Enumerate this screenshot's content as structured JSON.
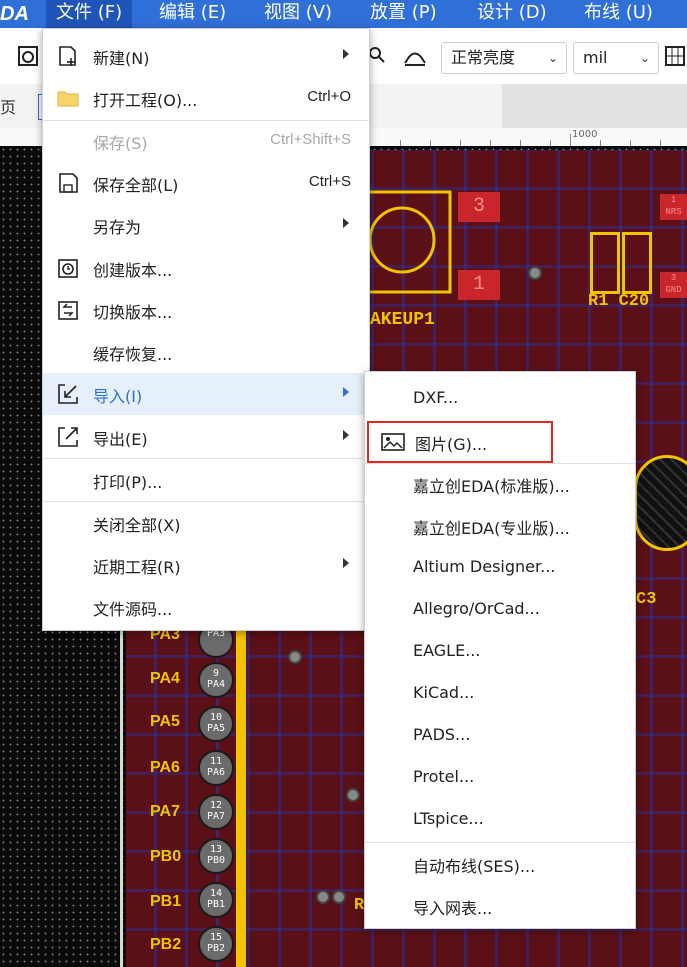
{
  "menubar": {
    "logo": "DA",
    "items": [
      {
        "label": "文件 (F)"
      },
      {
        "label": "编辑 (E)"
      },
      {
        "label": "视图 (V)"
      },
      {
        "label": "放置 (P)"
      },
      {
        "label": "设计 (D)"
      },
      {
        "label": "布线 (U)"
      }
    ]
  },
  "toolbar": {
    "brightness_select": "正常亮度",
    "unit_select": "mil"
  },
  "tabbar": {
    "left_fragment": "页"
  },
  "ruler": {
    "label": "1000"
  },
  "file_menu": {
    "items": [
      {
        "label": "新建(N)",
        "shortcut": "",
        "icon": "new-file-icon"
      },
      {
        "label": "打开工程(O)...",
        "shortcut": "Ctrl+O",
        "icon": "folder-icon"
      },
      {
        "label": "保存(S)",
        "shortcut": "Ctrl+Shift+S"
      },
      {
        "label": "保存全部(L)",
        "shortcut": "Ctrl+S",
        "icon": "save-icon"
      },
      {
        "label": "另存为",
        "shortcut": ""
      },
      {
        "label": "创建版本...",
        "shortcut": "",
        "icon": "create-version-icon"
      },
      {
        "label": "切换版本...",
        "shortcut": "",
        "icon": "switch-version-icon"
      },
      {
        "label": "缓存恢复...",
        "shortcut": ""
      },
      {
        "label": "导入(I)",
        "shortcut": "",
        "icon": "import-icon"
      },
      {
        "label": "导出(E)",
        "shortcut": "",
        "icon": "export-icon"
      },
      {
        "label": "打印(P)...",
        "shortcut": ""
      },
      {
        "label": "关闭全部(X)",
        "shortcut": ""
      },
      {
        "label": "近期工程(R)",
        "shortcut": ""
      },
      {
        "label": "文件源码...",
        "shortcut": ""
      }
    ]
  },
  "import_submenu": {
    "items": [
      {
        "label": "DXF..."
      },
      {
        "label": "图片(G)...",
        "icon": "image-icon"
      },
      {
        "label": "嘉立创EDA(标准版)..."
      },
      {
        "label": "嘉立创EDA(专业版)..."
      },
      {
        "label": "Altium Designer..."
      },
      {
        "label": "Allegro/OrCad..."
      },
      {
        "label": "EAGLE..."
      },
      {
        "label": "KiCad..."
      },
      {
        "label": "PADS..."
      },
      {
        "label": "Protel..."
      },
      {
        "label": "LTspice..."
      },
      {
        "label": "自动布线(SES)..."
      },
      {
        "label": "导入网表..."
      }
    ]
  },
  "pcb": {
    "labels": {
      "wakeup": "AKEUP1",
      "r1c20": "R1 C20",
      "c3": "C3",
      "r_frag": "R"
    },
    "pads": {
      "p3": "3",
      "p1": "1",
      "nrs_num": "1",
      "nrs": "NRS",
      "gnd_num": "3",
      "gnd": "GND"
    },
    "pins": [
      {
        "name": "PA3",
        "num": "",
        "sub": "PA3"
      },
      {
        "name": "PA4",
        "num": "9",
        "sub": "PA4"
      },
      {
        "name": "PA5",
        "num": "10",
        "sub": "PA5"
      },
      {
        "name": "PA6",
        "num": "11",
        "sub": "PA6"
      },
      {
        "name": "PA7",
        "num": "12",
        "sub": "PA7"
      },
      {
        "name": "PB0",
        "num": "13",
        "sub": "PB0"
      },
      {
        "name": "PB1",
        "num": "14",
        "sub": "PB1"
      },
      {
        "name": "PB2",
        "num": "15",
        "sub": "PB2"
      }
    ]
  },
  "colors": {
    "menubar": "#2f6fd8",
    "highlight": "#e5f0fb",
    "accent": "#2f6fd8",
    "board": "#5a1016",
    "silk": "#f2c400",
    "callout": "#e0281f"
  }
}
